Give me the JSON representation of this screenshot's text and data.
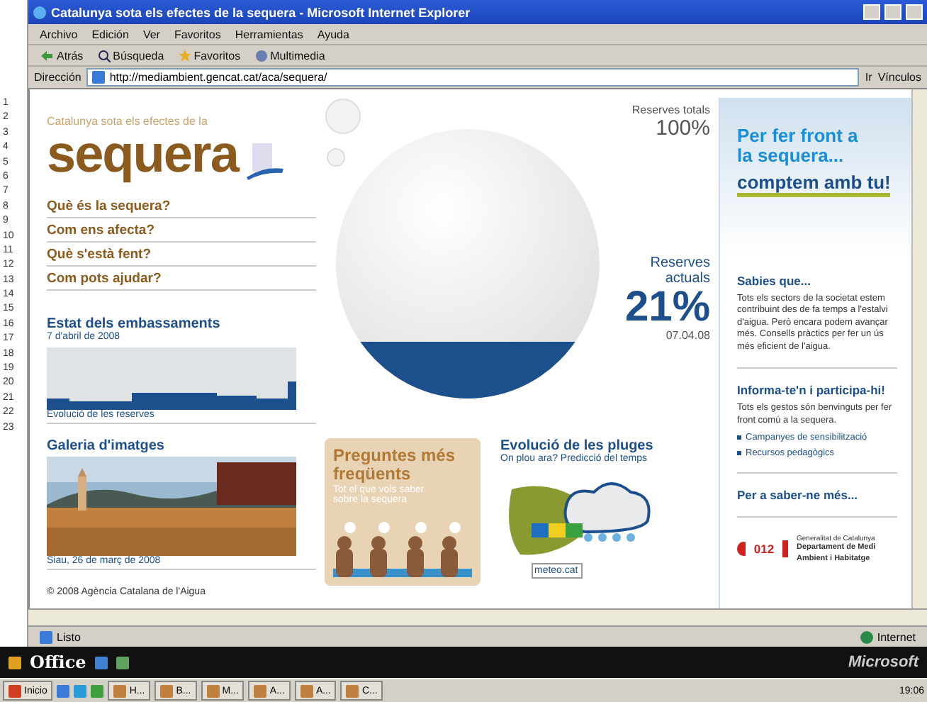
{
  "window": {
    "title": "Catalunya sota els efectes de la sequera - Microsoft Internet Explorer"
  },
  "menu": [
    "Archivo",
    "Edición",
    "Ver",
    "Favoritos",
    "Herramientas",
    "Ayuda"
  ],
  "toolbar": [
    {
      "kind": "back",
      "label": "Atrás"
    },
    {
      "kind": "search",
      "label": "Búsqueda"
    },
    {
      "kind": "favorites",
      "label": "Favoritos"
    },
    {
      "kind": "media",
      "label": "Multimedia"
    }
  ],
  "address": {
    "label": "Dirección",
    "value": "http://mediambient.gencat.cat/aca/sequera/",
    "go": "Ir",
    "links": "Vínculos"
  },
  "gutter": [
    "1",
    "2",
    "3",
    "4",
    "5",
    "6",
    "7",
    "8",
    "9",
    "10",
    "11",
    "12",
    "13",
    "14",
    "15",
    "16",
    "17",
    "18",
    "19",
    "20",
    "21",
    "22",
    "23"
  ],
  "logo": {
    "tagline": "Catalunya sota els efectes de la",
    "word": "sequera"
  },
  "nav": [
    "Què és la sequera?",
    "Com ens afecta?",
    "Què s'està fent?",
    "Com pots ajudar?"
  ],
  "reservoirs": {
    "title": "Estat dels embassaments",
    "date": "7 d'abril de 2008",
    "caption": "Evolució de les reserves"
  },
  "gallery": {
    "title": "Galeria d'imatges",
    "caption": "Siau, 26 de març de 2008"
  },
  "faq": {
    "title": "Preguntes més freqüents",
    "text": "Tot el que vols saber sobre la sequera"
  },
  "rain": {
    "title": "Evolució de les pluges",
    "subtitle": "On plou ara? Predicció del temps",
    "badge": "meteo.cat"
  },
  "bubble": {
    "total_label": "Reserves totals",
    "total": "100%",
    "current_label": "Reserves actuals",
    "current": "21%",
    "date": "07.04.08",
    "level": 0.21
  },
  "copyright": "© 2008 Agència Catalana de l'Aigua",
  "side": {
    "slogan": "Per fer front a la sequera...",
    "slogan_bold": "comptem amb tu!",
    "sections": [
      {
        "title": "Sabies que...",
        "text": "Tots els sectors de la societat estem contribuint des de fa temps a l'estalvi d'aigua. Però encara podem avançar més. Consells pràctics per fer un ús més eficient de l'aigua."
      },
      {
        "title": "Informa-te'n i participa-hi!",
        "text": "Tots els gestos són benvinguts per fer front comú a la sequera.",
        "links": [
          "Campanyes de sensibilització",
          "Recursos pedagògics"
        ]
      },
      {
        "title": "Per a saber-ne més..."
      }
    ],
    "phone": "012",
    "dept_small": "Generalitat de Catalunya",
    "dept": "Departament de Medi Ambient i Habitatge"
  },
  "status": {
    "text": "Listo",
    "zone": "Internet"
  },
  "office": {
    "label": "Office",
    "brand": "Microsoft"
  },
  "taskbar": {
    "start": "Inicio",
    "tasks": [
      "H...",
      "B...",
      "M...",
      "A...",
      "A...",
      "C..."
    ],
    "clock": "19:06"
  }
}
